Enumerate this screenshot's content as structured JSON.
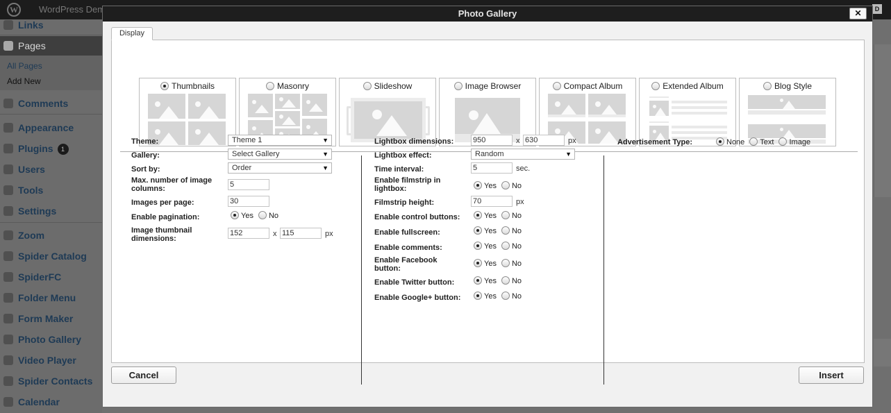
{
  "adminbar": {
    "site_name": "WordPress Dem"
  },
  "menu": {
    "links": "Links",
    "pages": "Pages",
    "all_pages": "All Pages",
    "add_new": "Add New",
    "comments": "Comments",
    "appearance": "Appearance",
    "plugins": "Plugins",
    "plugins_badge": "1",
    "users": "Users",
    "tools": "Tools",
    "settings": "Settings",
    "zoom": "Zoom",
    "spider_catalog": "Spider Catalog",
    "spiderfc": "SpiderFC",
    "folder_menu": "Folder Menu",
    "form_maker": "Form Maker",
    "photo_gallery": "Photo Gallery",
    "video_player": "Video Player",
    "spider_contacts": "Spider Contacts",
    "calendar": "Calendar"
  },
  "dialog": {
    "title": "Photo Gallery",
    "close": "✕",
    "tab": "Display",
    "views": [
      {
        "label": "Thumbnails",
        "selected": true
      },
      {
        "label": "Masonry",
        "selected": false
      },
      {
        "label": "Slideshow",
        "selected": false
      },
      {
        "label": "Image Browser",
        "selected": false
      },
      {
        "label": "Compact Album",
        "selected": false
      },
      {
        "label": "Extended Album",
        "selected": false
      },
      {
        "label": "Blog Style",
        "selected": false
      }
    ],
    "col1": {
      "theme_label": "Theme:",
      "theme_value": "Theme 1",
      "gallery_label": "Gallery:",
      "gallery_value": "Select Gallery",
      "sort_label": "Sort by:",
      "sort_value": "Order",
      "max_cols_label_1": "Max. number of image",
      "max_cols_label_2": "columns:",
      "max_cols_value": "5",
      "per_page_label": "Images per page:",
      "per_page_value": "30",
      "pagination_label": "Enable pagination:",
      "pagination_yes": "Yes",
      "pagination_no": "No",
      "pagination_selected": "Yes",
      "thumb_label_1": "Image thumbnail",
      "thumb_label_2": "dimensions:",
      "thumb_width": "152",
      "thumb_height": "115",
      "times": "x",
      "px": "px"
    },
    "col2": {
      "lb_dim_label": "Lightbox dimensions:",
      "lb_width": "950",
      "lb_height": "630",
      "times": "x",
      "px": "px",
      "lb_effect_label": "Lightbox effect:",
      "lb_effect_value": "Random",
      "interval_label": "Time interval:",
      "interval_value": "5",
      "sec": "sec.",
      "filmstrip_label_1": "Enable filmstrip in",
      "filmstrip_label_2": "lightbox:",
      "filmstrip_height_label": "Filmstrip height:",
      "filmstrip_height_value": "70",
      "control_label": "Enable control buttons:",
      "fullscreen_label": "Enable fullscreen:",
      "comments_label": "Enable comments:",
      "facebook_label_1": "Enable Facebook",
      "facebook_label_2": "button:",
      "twitter_label": "Enable Twitter button:",
      "google_label": "Enable Google+ button:",
      "yes": "Yes",
      "no": "No",
      "all_selected": "Yes"
    },
    "col3": {
      "ad_label": "Advertisement Type:",
      "none": "None",
      "text": "Text",
      "image": "Image",
      "selected": "None"
    },
    "cancel": "Cancel",
    "insert": "Insert"
  }
}
